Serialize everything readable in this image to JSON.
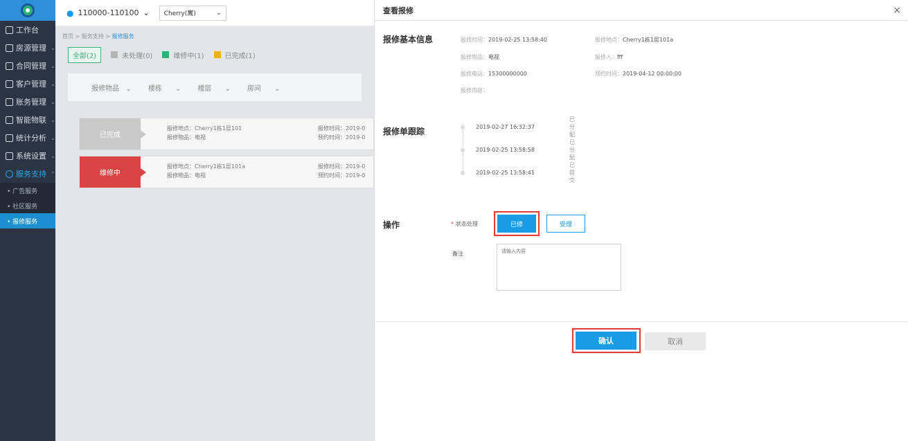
{
  "sidebar": {
    "items": [
      {
        "label": "工作台",
        "chev": ""
      },
      {
        "label": "房源管理",
        "chev": "⌄"
      },
      {
        "label": "合同管理",
        "chev": "⌄"
      },
      {
        "label": "客户管理",
        "chev": "⌄"
      },
      {
        "label": "账务管理",
        "chev": "⌄"
      },
      {
        "label": "智能物联",
        "chev": "⌄"
      },
      {
        "label": "统计分析",
        "chev": "⌄"
      },
      {
        "label": "系统设置",
        "chev": "⌄"
      },
      {
        "label": "服务支持",
        "chev": "⌃"
      }
    ],
    "subitems": [
      "• 广告服务",
      "• 社区服务",
      "• 报修服务"
    ]
  },
  "topbar": {
    "location": "110000-110100",
    "location_chev": "⌄",
    "project": "Cherry(寓)",
    "project_chev": "⌄"
  },
  "main": {
    "breadcrumb": {
      "home": "首页",
      "sep1": " > ",
      "parent": "服务支持",
      "sep2": " > ",
      "current": "报修服务"
    },
    "filters": [
      {
        "label": "全部(2)"
      },
      {
        "label": "未处理(0)",
        "color": "#b5b5b5"
      },
      {
        "label": "维修中(1)",
        "color": "#2bb27b"
      },
      {
        "label": "已完成(1)",
        "color": "#f2b01e"
      }
    ],
    "selects": [
      "报修物品",
      "楼栋",
      "楼层",
      "房间"
    ],
    "select_chev": "⌄",
    "cards": [
      {
        "status": "已完成",
        "place": "报修地点：Cherry1栋1层101",
        "item": "报修物品：电视",
        "time": "报修时间：2019-0",
        "appt": "预约时间：2019-0"
      },
      {
        "status": "维修中",
        "place": "报修地点：Cherry1栋1层101a",
        "item": "报修物品：电视",
        "time": "报修时间：2019-0",
        "appt": "预约时间：2019-0"
      }
    ]
  },
  "drawer": {
    "title": "查看报修",
    "close": "×",
    "basic_title": "报修基本信息",
    "basic": {
      "report_time_label": "报修时间：",
      "report_time": "2019-02-25 13:58:40",
      "place_label": "报修地点：",
      "place": "Cherry1栋1层101a",
      "item_label": "报修物品：",
      "item": "电视",
      "reporter_label": "报修人：",
      "reporter": "fff",
      "phone_label": "报修电话：",
      "phone": "15300000000",
      "appt_label": "预约时间：",
      "appt": "2019-04-12 00:00:00",
      "content_label": "报修内容："
    },
    "track_title": "报修单跟踪",
    "track": [
      {
        "time": "2019-02-27 16:32:37",
        "status": "已分配"
      },
      {
        "time": "2019-02-25 13:58:58",
        "status": "已分配"
      },
      {
        "time": "2019-02-25 13:58:41",
        "status": "已提交"
      }
    ],
    "op_title": "操作",
    "state_star": "*",
    "state_label": "状态处理",
    "btn_repaired": "已修",
    "btn_accept": "受理",
    "remark_label": "备注",
    "remark_placeholder": "请输入内容",
    "confirm": "确认",
    "cancel": "取消"
  },
  "colors": {
    "accent": "#1a9be6",
    "highlight": "#e23b3b",
    "sidebar": "#2b3443"
  }
}
